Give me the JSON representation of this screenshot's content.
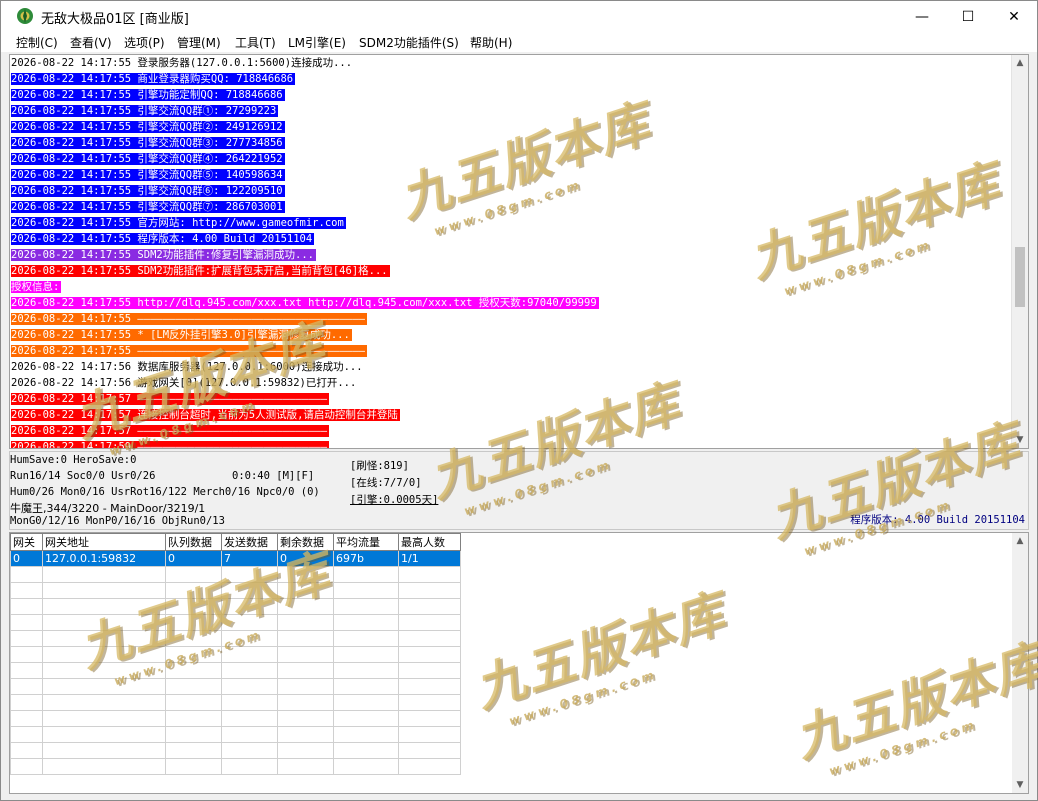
{
  "window": {
    "title": "无敌大极品01区 [商业版]",
    "controls": {
      "minimize": "—",
      "maximize": "☐",
      "close": "✕"
    }
  },
  "menu": [
    "控制(C)",
    "查看(V)",
    "选项(P)",
    "管理(M)",
    "工具(T)",
    "LM引擎(E)",
    "SDM2功能插件(S)",
    "帮助(H)"
  ],
  "log": [
    {
      "time": "2026-08-22 14:17:55",
      "msg": "登录服务器(127.0.0.1:5600)连接成功...",
      "bg": "#ffffff",
      "fg": "#000000"
    },
    {
      "time": "2026-08-22 14:17:55",
      "msg": "商业登录器购买QQ: 718846686",
      "bg": "#0000ff",
      "fg": "#ffffff"
    },
    {
      "time": "2026-08-22 14:17:55",
      "msg": "引擎功能定制QQ: 718846686",
      "bg": "#0000ff",
      "fg": "#ffffff"
    },
    {
      "time": "2026-08-22 14:17:55",
      "msg": "引擎交流QQ群①: 27299223",
      "bg": "#0000ff",
      "fg": "#ffffff"
    },
    {
      "time": "2026-08-22 14:17:55",
      "msg": "引擎交流QQ群②: 249126912",
      "bg": "#0000ff",
      "fg": "#ffffff"
    },
    {
      "time": "2026-08-22 14:17:55",
      "msg": "引擎交流QQ群③: 277734856",
      "bg": "#0000ff",
      "fg": "#ffffff"
    },
    {
      "time": "2026-08-22 14:17:55",
      "msg": "引擎交流QQ群④: 264221952",
      "bg": "#0000ff",
      "fg": "#ffffff"
    },
    {
      "time": "2026-08-22 14:17:55",
      "msg": "引擎交流QQ群⑤: 140598634",
      "bg": "#0000ff",
      "fg": "#ffffff"
    },
    {
      "time": "2026-08-22 14:17:55",
      "msg": "引擎交流QQ群⑥: 122209510",
      "bg": "#0000ff",
      "fg": "#ffffff"
    },
    {
      "time": "2026-08-22 14:17:55",
      "msg": "引擎交流QQ群⑦: 286703001",
      "bg": "#0000ff",
      "fg": "#ffffff"
    },
    {
      "time": "2026-08-22 14:17:55",
      "msg": "官方网站: http://www.gameofmir.com",
      "bg": "#0000ff",
      "fg": "#ffffff"
    },
    {
      "time": "2026-08-22 14:17:55",
      "msg": "程序版本: 4.00 Build 20151104",
      "bg": "#0000ff",
      "fg": "#ffffff"
    },
    {
      "time": "2026-08-22 14:17:55",
      "msg": "SDM2功能插件:修复引擎漏洞成功...",
      "bg": "#8a2be2",
      "fg": "#ffffff"
    },
    {
      "time": "2026-08-22 14:17:55",
      "msg": "SDM2功能插件:扩展背包未开启,当前背包[46]格...",
      "bg": "#ff0000",
      "fg": "#ffffff"
    },
    {
      "time": "",
      "msg": "授权信息:",
      "bg": "#ff00ff",
      "fg": "#ffffff"
    },
    {
      "time": "2026-08-22 14:17:55",
      "msg": "http://dlq.945.com/xxx.txt http://dlq.945.com/xxx.txt 授权天数:97040/99999",
      "bg": "#ff00ff",
      "fg": "#ffffff"
    },
    {
      "time": "2026-08-22 14:17:55",
      "msg": "————————————————————————————————————",
      "bg": "#ff6a00",
      "fg": "#ffffff"
    },
    {
      "time": "2026-08-22 14:17:55",
      "msg": "* [LM反外挂引擎3.0]引擎漏洞修复成功...",
      "bg": "#ff6a00",
      "fg": "#ffffff"
    },
    {
      "time": "2026-08-22 14:17:55",
      "msg": "————————————————————————————————————",
      "bg": "#ff6a00",
      "fg": "#ffffff"
    },
    {
      "time": "2026-08-22 14:17:56",
      "msg": "数据库服务器(127.0.0.1:6000)连接成功...",
      "bg": "#ffffff",
      "fg": "#000000"
    },
    {
      "time": "2026-08-22 14:17:56",
      "msg": "游戏网关[0](127.0.0.1:59832)已打开...",
      "bg": "#ffffff",
      "fg": "#000000"
    },
    {
      "time": "2026-08-22 14:17:57",
      "msg": "——————————————————————————————",
      "bg": "#ff0000",
      "fg": "#ffffff"
    },
    {
      "time": "2026-08-22 14:17:57",
      "msg": "连接控制台超时,当前为5人测试版,请启动控制台并登陆",
      "bg": "#ff0000",
      "fg": "#ffffff"
    },
    {
      "time": "2026-08-22 14:17:57",
      "msg": "——————————————————————————————",
      "bg": "#ff0000",
      "fg": "#ffffff"
    },
    {
      "time": "2026-08-22 14:17:59",
      "msg": "——————————————————————————————",
      "bg": "#ff0000",
      "fg": "#ffffff"
    }
  ],
  "status": {
    "line1": "HumSave:0 HeroSave:0",
    "line2a": "Run16/14 Soc0/0 Usr0/26",
    "line2b": "0:0:40 [M][F]",
    "line3": "Hum0/26 Mon0/16 UsrRot16/122 Merch0/16 Npc0/0 (0)",
    "line4": "牛魔王,344/3220 - MainDoor/3219/1",
    "line5": "MonG0/12/16 MonP0/16/16 ObjRun0/13",
    "refresh": "[刷怪:819]",
    "online": "[在线:7/7/0]",
    "engine": "[引擎:0.0005天]",
    "build": "程序版本: 4.00 Build 20151104"
  },
  "grid": {
    "headers": [
      "网关",
      "网关地址",
      "队列数据",
      "发送数据",
      "剩余数据",
      "平均流量",
      "最高人数"
    ],
    "rows": [
      [
        "0",
        "127.0.0.1:59832",
        "0",
        "7",
        "0",
        "697b",
        "1/1"
      ]
    ]
  },
  "watermark": {
    "title": "九五版本库",
    "url": "www.08gm.com"
  },
  "colors": {
    "accent": "#0078d7",
    "build_text": "#000080"
  }
}
